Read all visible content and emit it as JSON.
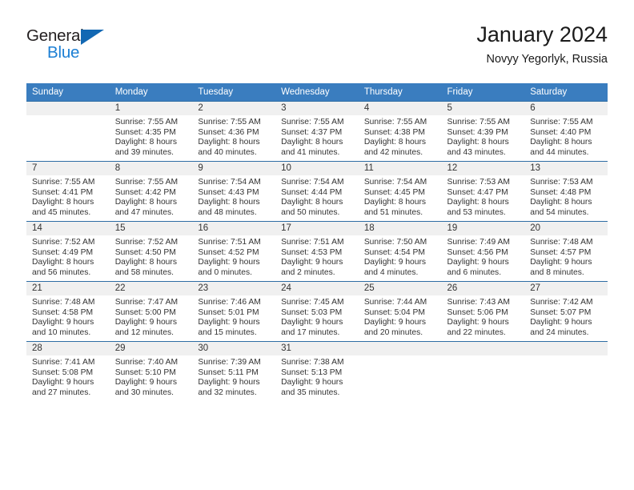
{
  "brand": {
    "name_top": "General",
    "name_bottom": "Blue",
    "triangle_color": "#1268b3",
    "blue_text_color": "#1c7fd4"
  },
  "header": {
    "title": "January 2024",
    "subtitle": "Novyy Yegorlyk, Russia"
  },
  "theme": {
    "header_row_bg": "#3a7dbf",
    "cell_border_top": "#2e6da4",
    "daynum_band_bg": "#f0f0f0",
    "text_color": "#333333"
  },
  "weekday_headers": [
    "Sunday",
    "Monday",
    "Tuesday",
    "Wednesday",
    "Thursday",
    "Friday",
    "Saturday"
  ],
  "weeks": [
    [
      {
        "day": "",
        "sunrise": "",
        "sunset": "",
        "daylight_1": "",
        "daylight_2": ""
      },
      {
        "day": "1",
        "sunrise": "Sunrise: 7:55 AM",
        "sunset": "Sunset: 4:35 PM",
        "daylight_1": "Daylight: 8 hours",
        "daylight_2": "and 39 minutes."
      },
      {
        "day": "2",
        "sunrise": "Sunrise: 7:55 AM",
        "sunset": "Sunset: 4:36 PM",
        "daylight_1": "Daylight: 8 hours",
        "daylight_2": "and 40 minutes."
      },
      {
        "day": "3",
        "sunrise": "Sunrise: 7:55 AM",
        "sunset": "Sunset: 4:37 PM",
        "daylight_1": "Daylight: 8 hours",
        "daylight_2": "and 41 minutes."
      },
      {
        "day": "4",
        "sunrise": "Sunrise: 7:55 AM",
        "sunset": "Sunset: 4:38 PM",
        "daylight_1": "Daylight: 8 hours",
        "daylight_2": "and 42 minutes."
      },
      {
        "day": "5",
        "sunrise": "Sunrise: 7:55 AM",
        "sunset": "Sunset: 4:39 PM",
        "daylight_1": "Daylight: 8 hours",
        "daylight_2": "and 43 minutes."
      },
      {
        "day": "6",
        "sunrise": "Sunrise: 7:55 AM",
        "sunset": "Sunset: 4:40 PM",
        "daylight_1": "Daylight: 8 hours",
        "daylight_2": "and 44 minutes."
      }
    ],
    [
      {
        "day": "7",
        "sunrise": "Sunrise: 7:55 AM",
        "sunset": "Sunset: 4:41 PM",
        "daylight_1": "Daylight: 8 hours",
        "daylight_2": "and 45 minutes."
      },
      {
        "day": "8",
        "sunrise": "Sunrise: 7:55 AM",
        "sunset": "Sunset: 4:42 PM",
        "daylight_1": "Daylight: 8 hours",
        "daylight_2": "and 47 minutes."
      },
      {
        "day": "9",
        "sunrise": "Sunrise: 7:54 AM",
        "sunset": "Sunset: 4:43 PM",
        "daylight_1": "Daylight: 8 hours",
        "daylight_2": "and 48 minutes."
      },
      {
        "day": "10",
        "sunrise": "Sunrise: 7:54 AM",
        "sunset": "Sunset: 4:44 PM",
        "daylight_1": "Daylight: 8 hours",
        "daylight_2": "and 50 minutes."
      },
      {
        "day": "11",
        "sunrise": "Sunrise: 7:54 AM",
        "sunset": "Sunset: 4:45 PM",
        "daylight_1": "Daylight: 8 hours",
        "daylight_2": "and 51 minutes."
      },
      {
        "day": "12",
        "sunrise": "Sunrise: 7:53 AM",
        "sunset": "Sunset: 4:47 PM",
        "daylight_1": "Daylight: 8 hours",
        "daylight_2": "and 53 minutes."
      },
      {
        "day": "13",
        "sunrise": "Sunrise: 7:53 AM",
        "sunset": "Sunset: 4:48 PM",
        "daylight_1": "Daylight: 8 hours",
        "daylight_2": "and 54 minutes."
      }
    ],
    [
      {
        "day": "14",
        "sunrise": "Sunrise: 7:52 AM",
        "sunset": "Sunset: 4:49 PM",
        "daylight_1": "Daylight: 8 hours",
        "daylight_2": "and 56 minutes."
      },
      {
        "day": "15",
        "sunrise": "Sunrise: 7:52 AM",
        "sunset": "Sunset: 4:50 PM",
        "daylight_1": "Daylight: 8 hours",
        "daylight_2": "and 58 minutes."
      },
      {
        "day": "16",
        "sunrise": "Sunrise: 7:51 AM",
        "sunset": "Sunset: 4:52 PM",
        "daylight_1": "Daylight: 9 hours",
        "daylight_2": "and 0 minutes."
      },
      {
        "day": "17",
        "sunrise": "Sunrise: 7:51 AM",
        "sunset": "Sunset: 4:53 PM",
        "daylight_1": "Daylight: 9 hours",
        "daylight_2": "and 2 minutes."
      },
      {
        "day": "18",
        "sunrise": "Sunrise: 7:50 AM",
        "sunset": "Sunset: 4:54 PM",
        "daylight_1": "Daylight: 9 hours",
        "daylight_2": "and 4 minutes."
      },
      {
        "day": "19",
        "sunrise": "Sunrise: 7:49 AM",
        "sunset": "Sunset: 4:56 PM",
        "daylight_1": "Daylight: 9 hours",
        "daylight_2": "and 6 minutes."
      },
      {
        "day": "20",
        "sunrise": "Sunrise: 7:48 AM",
        "sunset": "Sunset: 4:57 PM",
        "daylight_1": "Daylight: 9 hours",
        "daylight_2": "and 8 minutes."
      }
    ],
    [
      {
        "day": "21",
        "sunrise": "Sunrise: 7:48 AM",
        "sunset": "Sunset: 4:58 PM",
        "daylight_1": "Daylight: 9 hours",
        "daylight_2": "and 10 minutes."
      },
      {
        "day": "22",
        "sunrise": "Sunrise: 7:47 AM",
        "sunset": "Sunset: 5:00 PM",
        "daylight_1": "Daylight: 9 hours",
        "daylight_2": "and 12 minutes."
      },
      {
        "day": "23",
        "sunrise": "Sunrise: 7:46 AM",
        "sunset": "Sunset: 5:01 PM",
        "daylight_1": "Daylight: 9 hours",
        "daylight_2": "and 15 minutes."
      },
      {
        "day": "24",
        "sunrise": "Sunrise: 7:45 AM",
        "sunset": "Sunset: 5:03 PM",
        "daylight_1": "Daylight: 9 hours",
        "daylight_2": "and 17 minutes."
      },
      {
        "day": "25",
        "sunrise": "Sunrise: 7:44 AM",
        "sunset": "Sunset: 5:04 PM",
        "daylight_1": "Daylight: 9 hours",
        "daylight_2": "and 20 minutes."
      },
      {
        "day": "26",
        "sunrise": "Sunrise: 7:43 AM",
        "sunset": "Sunset: 5:06 PM",
        "daylight_1": "Daylight: 9 hours",
        "daylight_2": "and 22 minutes."
      },
      {
        "day": "27",
        "sunrise": "Sunrise: 7:42 AM",
        "sunset": "Sunset: 5:07 PM",
        "daylight_1": "Daylight: 9 hours",
        "daylight_2": "and 24 minutes."
      }
    ],
    [
      {
        "day": "28",
        "sunrise": "Sunrise: 7:41 AM",
        "sunset": "Sunset: 5:08 PM",
        "daylight_1": "Daylight: 9 hours",
        "daylight_2": "and 27 minutes."
      },
      {
        "day": "29",
        "sunrise": "Sunrise: 7:40 AM",
        "sunset": "Sunset: 5:10 PM",
        "daylight_1": "Daylight: 9 hours",
        "daylight_2": "and 30 minutes."
      },
      {
        "day": "30",
        "sunrise": "Sunrise: 7:39 AM",
        "sunset": "Sunset: 5:11 PM",
        "daylight_1": "Daylight: 9 hours",
        "daylight_2": "and 32 minutes."
      },
      {
        "day": "31",
        "sunrise": "Sunrise: 7:38 AM",
        "sunset": "Sunset: 5:13 PM",
        "daylight_1": "Daylight: 9 hours",
        "daylight_2": "and 35 minutes."
      },
      {
        "day": "",
        "sunrise": "",
        "sunset": "",
        "daylight_1": "",
        "daylight_2": ""
      },
      {
        "day": "",
        "sunrise": "",
        "sunset": "",
        "daylight_1": "",
        "daylight_2": ""
      },
      {
        "day": "",
        "sunrise": "",
        "sunset": "",
        "daylight_1": "",
        "daylight_2": ""
      }
    ]
  ]
}
